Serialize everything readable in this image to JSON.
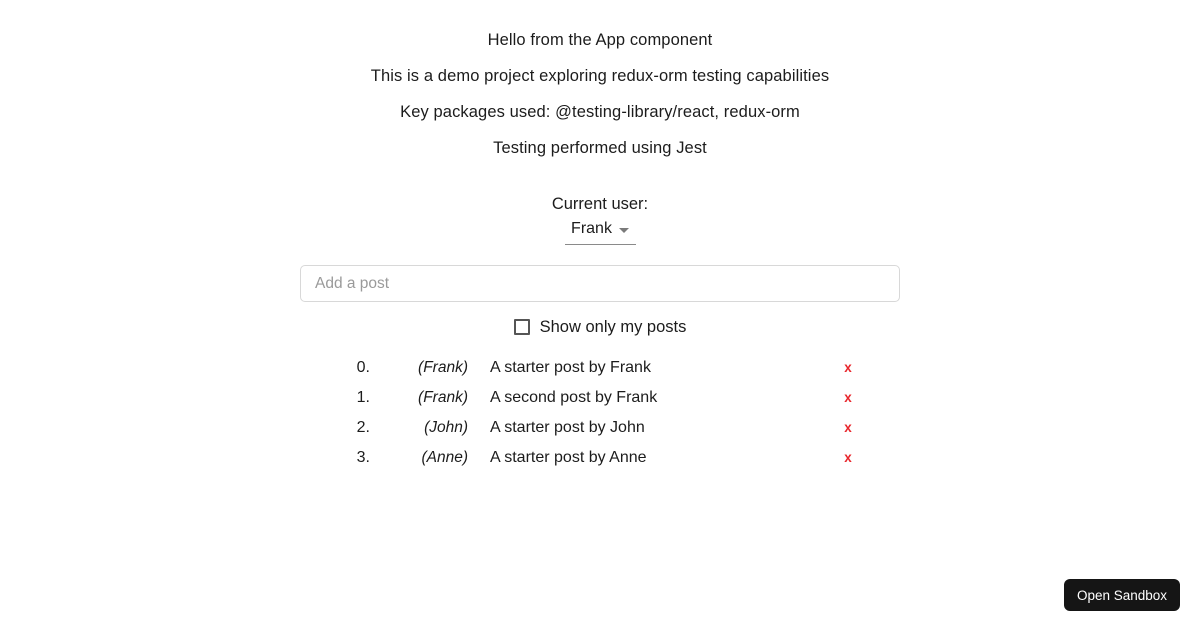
{
  "intro": {
    "lines": [
      "Hello from the App component",
      "This is a demo project exploring redux-orm testing capabilities",
      "Key packages used: @testing-library/react, redux-orm",
      "Testing performed using Jest"
    ]
  },
  "user_section": {
    "label": "Current user:",
    "selected_user": "Frank",
    "caret_icon": "chevron-down-icon"
  },
  "add_post": {
    "value": "",
    "placeholder": "Add a post"
  },
  "filter": {
    "label": "Show only my posts",
    "checked": false
  },
  "posts": {
    "rows": [
      {
        "index": "0.",
        "author": "(Frank)",
        "text": "A starter post by Frank",
        "delete_label": "x"
      },
      {
        "index": "1.",
        "author": "(Frank)",
        "text": "A second post by Frank",
        "delete_label": "x"
      },
      {
        "index": "2.",
        "author": "(John)",
        "text": "A starter post by John",
        "delete_label": "x"
      },
      {
        "index": "3.",
        "author": "(Anne)",
        "text": "A starter post by Anne",
        "delete_label": "x"
      }
    ]
  },
  "sandbox_button": {
    "label": "Open Sandbox"
  },
  "colors": {
    "text": "#1c1c1c",
    "placeholder": "#9a9a9a",
    "input_border": "#d8d8d8",
    "delete_red": "#e8262c",
    "sandbox_bg": "#151515"
  }
}
